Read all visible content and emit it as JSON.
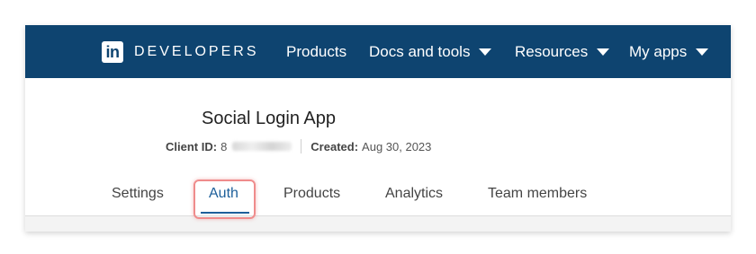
{
  "header": {
    "brand_logo_text": "in",
    "brand_word": "DEVELOPERS",
    "nav": [
      {
        "label": "Products",
        "has_dropdown": false
      },
      {
        "label": "Docs and tools",
        "has_dropdown": true
      },
      {
        "label": "Resources",
        "has_dropdown": true
      },
      {
        "label": "My apps",
        "has_dropdown": true
      }
    ]
  },
  "app": {
    "title": "Social Login App",
    "client_id_label": "Client ID:",
    "client_id_value_visible": "8",
    "created_label": "Created:",
    "created_value": "Aug 30, 2023"
  },
  "tabs": [
    {
      "label": "Settings",
      "active": false
    },
    {
      "label": "Auth",
      "active": true
    },
    {
      "label": "Products",
      "active": false
    },
    {
      "label": "Analytics",
      "active": false
    },
    {
      "label": "Team members",
      "active": false
    }
  ],
  "colors": {
    "topbar": "#0e4470",
    "active_tab": "#1d5f9a",
    "highlight": "#ef8c8c"
  }
}
